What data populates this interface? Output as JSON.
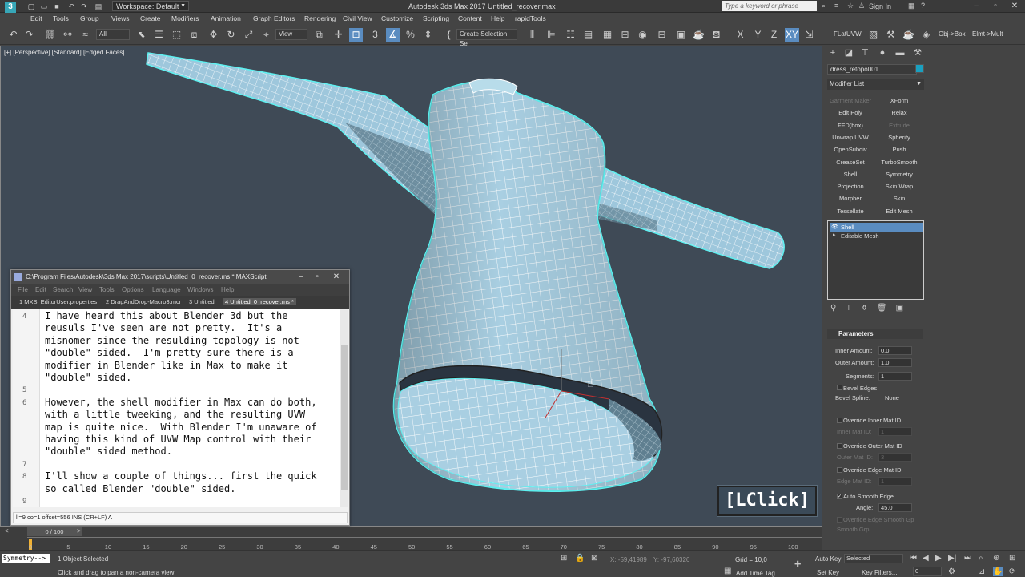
{
  "title_bar": {
    "workspace": "Workspace: Default",
    "window_title": "Autodesk 3ds Max 2017    Untitled_recover.max",
    "search_placeholder": "Type a keyword or phrase",
    "sign_in": "Sign In"
  },
  "menu": [
    "Edit",
    "Tools",
    "Group",
    "Views",
    "Create",
    "Modifiers",
    "Animation",
    "Graph Editors",
    "Rendering",
    "Civil View",
    "Customize",
    "Scripting",
    "Content",
    "Help",
    "rapidTools"
  ],
  "toolbar": {
    "filter": "All",
    "ref_coord": "View",
    "selection_set": "Create Selection Se",
    "axes": [
      "X",
      "Y",
      "Z",
      "XY"
    ],
    "flatuvw": "FLatUVW",
    "obj_box": "Obj->Box",
    "elmt_multi": "Elmt->Mult"
  },
  "viewport": {
    "label": "[+] [Perspective] [Standard] [Edged Faces]",
    "lclick": "[LClick]"
  },
  "command_panel": {
    "object_name": "dress_retopo001",
    "object_color": "#1aa0c0",
    "modifier_list": "Modifier List",
    "modifier_buttons": [
      {
        "label": "Garment Maker",
        "enabled": false
      },
      {
        "label": "XForm",
        "enabled": true
      },
      {
        "label": "Edit Poly",
        "enabled": true
      },
      {
        "label": "Relax",
        "enabled": true
      },
      {
        "label": "FFD(box)",
        "enabled": true
      },
      {
        "label": "Extrude",
        "enabled": false
      },
      {
        "label": "Unwrap UVW",
        "enabled": true
      },
      {
        "label": "Spherify",
        "enabled": true
      },
      {
        "label": "OpenSubdiv",
        "enabled": true
      },
      {
        "label": "Push",
        "enabled": true
      },
      {
        "label": "CreaseSet",
        "enabled": true
      },
      {
        "label": "TurboSmooth",
        "enabled": true
      },
      {
        "label": "Shell",
        "enabled": true
      },
      {
        "label": "Symmetry",
        "enabled": true
      },
      {
        "label": "Projection",
        "enabled": true
      },
      {
        "label": "Skin Wrap",
        "enabled": true
      },
      {
        "label": "Morpher",
        "enabled": true
      },
      {
        "label": "Skin",
        "enabled": true
      },
      {
        "label": "Tessellate",
        "enabled": true
      },
      {
        "label": "Edit Mesh",
        "enabled": true
      }
    ],
    "stack": [
      "Shell",
      "Editable Mesh"
    ],
    "parameters": {
      "title": "Parameters",
      "inner_amount_label": "Inner Amount:",
      "inner_amount": "0.0",
      "outer_amount_label": "Outer Amount:",
      "outer_amount": "1.0",
      "segments_label": "Segments:",
      "segments": "1",
      "bevel_edges": "Bevel Edges",
      "bevel_spline_label": "Bevel Spline:",
      "bevel_spline": "None",
      "override_inner": "Override Inner Mat ID",
      "inner_mat_label": "Inner Mat ID:",
      "inner_mat": "1",
      "override_outer": "Override Outer Mat ID",
      "outer_mat_label": "Outer Mat ID:",
      "outer_mat": "3",
      "override_edge": "Override Edge Mat ID",
      "edge_mat_label": "Edge Mat ID:",
      "edge_mat": "1",
      "auto_smooth": "Auto Smooth Edge",
      "angle_label": "Angle:",
      "angle": "45.0",
      "override_edge_smooth": "Override Edge Smooth Gp",
      "smooth_grp_label": "Smooth Grp:",
      "smooth_grp": "1"
    }
  },
  "maxscript": {
    "title": "C:\\Program Files\\Autodesk\\3ds Max 2017\\scripts\\Untitled_0_recover.ms * MAXScript",
    "menu": [
      "File",
      "Edit",
      "Search",
      "View",
      "Tools",
      "Options",
      "Language",
      "Windows",
      "Help"
    ],
    "tabs": [
      "1 MXS_EditorUser.properties",
      "2 DragAndDrop-Macro3.mcr",
      "3 Untitled",
      "4 Untitled_0_recover.ms *"
    ],
    "lines": [
      {
        "num": "4",
        "text": "I have heard this about Blender 3d but the"
      },
      {
        "num": "",
        "text": "reusuls I've seen are not pretty.  It's a"
      },
      {
        "num": "",
        "text": "misnomer since the resulding topology is not"
      },
      {
        "num": "",
        "text": "\"double\" sided.  I'm pretty sure there is a"
      },
      {
        "num": "",
        "text": "modifier in Blender like in Max to make it"
      },
      {
        "num": "",
        "text": "\"double\" sided."
      },
      {
        "num": "5",
        "text": ""
      },
      {
        "num": "6",
        "text": "However, the shell modifier in Max can do both,"
      },
      {
        "num": "",
        "text": "with a little tweeking, and the resulting UVW"
      },
      {
        "num": "",
        "text": "map is quite nice.  With Blender I'm unaware of"
      },
      {
        "num": "",
        "text": "having this kind of UVW Map control with their"
      },
      {
        "num": "",
        "text": "\"double\" sided method."
      },
      {
        "num": "7",
        "text": ""
      },
      {
        "num": "8",
        "text": "I'll show a couple of things... first the quick"
      },
      {
        "num": "",
        "text": "so called Blender \"double\" sided."
      },
      {
        "num": "9",
        "text": ""
      }
    ],
    "status": "li=9 co=1 offset=556 INS (CR+LF) A"
  },
  "timeline": {
    "slider": "0 / 100",
    "ticks": [
      "0",
      "5",
      "10",
      "15",
      "20",
      "25",
      "30",
      "35",
      "40",
      "45",
      "50",
      "55",
      "60",
      "65",
      "70",
      "75",
      "80",
      "85",
      "90",
      "95",
      "100"
    ]
  },
  "status_bar": {
    "listener": "Symmetry-->",
    "selected": "1 Object Selected",
    "prompt": "Click and drag to pan a non-camera view",
    "x_coord": "X: -59,41989",
    "y_coord": "Y: -97,60326",
    "grid": "Grid = 10,0",
    "add_time_tag": "Add Time Tag",
    "auto_key": "Auto Key",
    "key_mode": "Selected",
    "set_key": "Set Key",
    "key_filters": "Key Filters...",
    "frame": "0"
  }
}
